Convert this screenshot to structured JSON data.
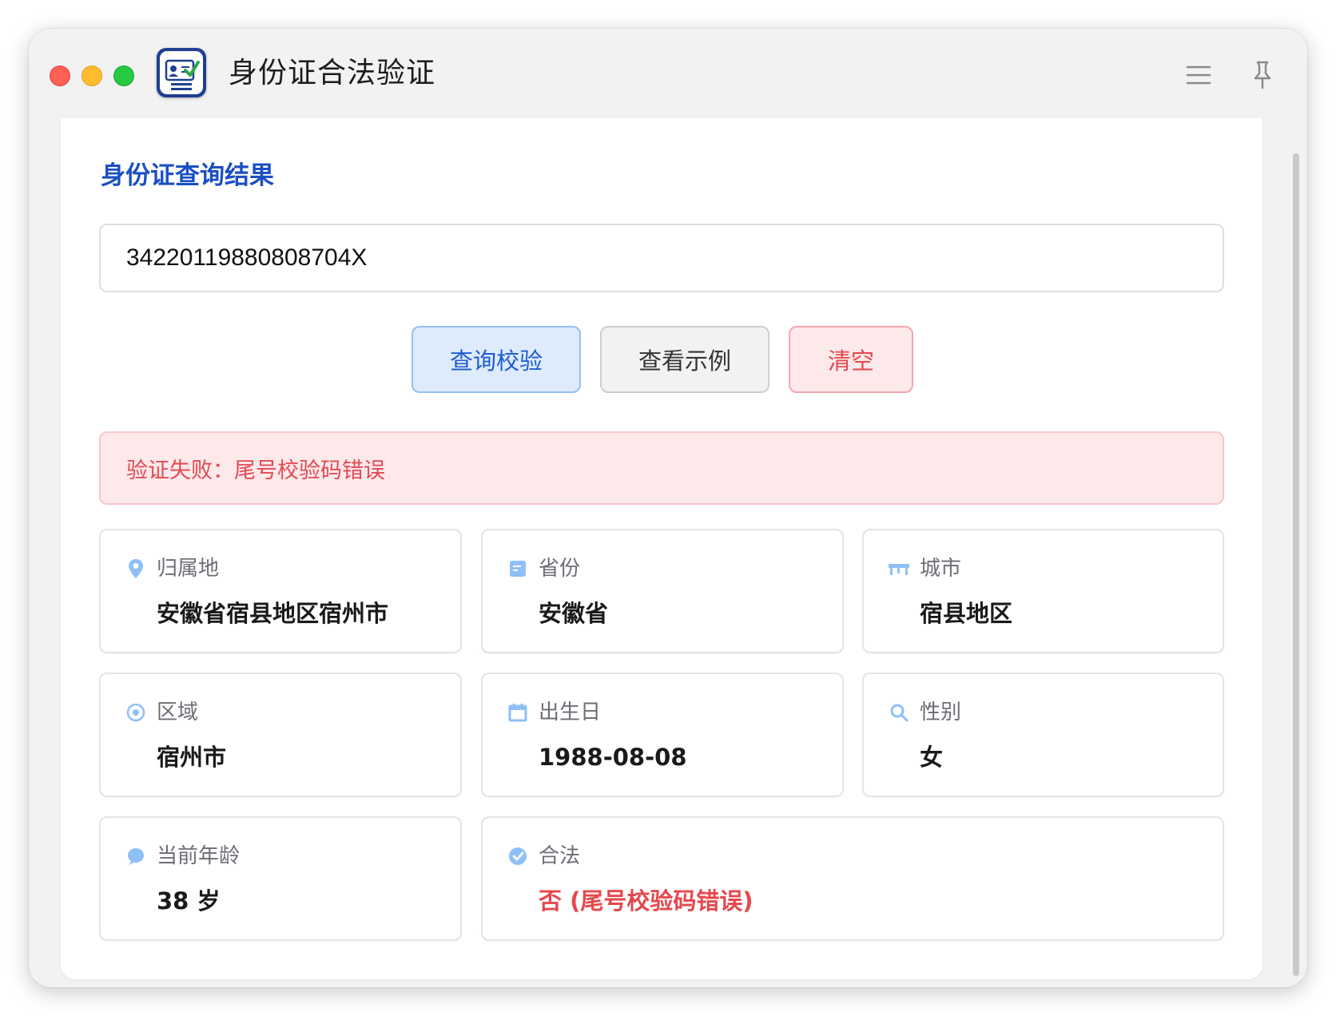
{
  "window": {
    "title": "身份证合法验证"
  },
  "page": {
    "section_title": "身份证查询结果"
  },
  "id_input": {
    "value": "34220119880808704X"
  },
  "buttons": {
    "query": "查询校验",
    "sample": "查看示例",
    "clear": "清空"
  },
  "alert": {
    "message": "验证失败：尾号校验码错误"
  },
  "fields": {
    "location": {
      "label": "归属地",
      "value": "安徽省宿县地区宿州市",
      "icon": "location-pin-icon"
    },
    "province": {
      "label": "省份",
      "value": "安徽省",
      "icon": "document-icon"
    },
    "city": {
      "label": "城市",
      "value": "宿县地区",
      "icon": "city-icon"
    },
    "district": {
      "label": "区域",
      "value": "宿州市",
      "icon": "target-icon"
    },
    "birthday": {
      "label": "出生日",
      "value": "1988-08-08",
      "icon": "calendar-icon"
    },
    "gender": {
      "label": "性别",
      "value": "女",
      "icon": "search-icon"
    },
    "age": {
      "label": "当前年龄",
      "value": "38 岁",
      "icon": "chat-bubble-icon"
    },
    "legal": {
      "label": "合法",
      "value": "否 (尾号校验码错误)",
      "icon": "check-circle-icon"
    }
  },
  "colors": {
    "accent": "#1b4fc4",
    "danger": "#e5484d",
    "icon_blue": "#8ec0f7"
  }
}
